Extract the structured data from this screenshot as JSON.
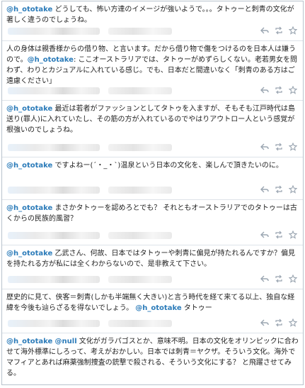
{
  "tweets": [
    {
      "mention": "@h_ototake",
      "segments": [
        {
          "t": "mention",
          "v": "@h_ototake"
        },
        {
          "t": "text",
          "v": " どうしても、怖い方達のイメージが強いようで。。。タトゥーと刺青の文化が著しく違うのでしょうね。"
        }
      ]
    },
    {
      "segments": [
        {
          "t": "text",
          "v": "人の身体は親香様からの借り物、と言います。だから借り物で傷をつけるのを日本人は嫌うので。"
        },
        {
          "t": "mention",
          "v": "@h_ototake"
        },
        {
          "t": "text",
          "v": ": ここオーストラリアでは、タトゥーがめずらしくない。老若男女を問わず、わりとカジュアルに入れている感じ。でも、日本だと間違いなく「刺青のある方はご遠慮ください」"
        }
      ]
    },
    {
      "segments": [
        {
          "t": "mention",
          "v": "@h_ototake"
        },
        {
          "t": "text",
          "v": " 最近は若者がファッションとしてタトゥを入ますが、そもそも江戸時代は島送り(罪人)に入れていたし、その筋の方が入れているのでやはりアウトロー人という感覚が根強いのでしょうね。"
        }
      ]
    },
    {
      "segments": [
        {
          "t": "mention",
          "v": "@h_ototake"
        },
        {
          "t": "text",
          "v": " ですよねー(´・_・`)温泉という日本の文化を、楽しんで頂きたいのに。"
        }
      ]
    },
    {
      "segments": [
        {
          "t": "mention",
          "v": "@h_ototake"
        },
        {
          "t": "text",
          "v": " まさかタトゥーを認めろとでも？ それともオーストラリアでのタトゥーは古くからの民族的風習？"
        }
      ]
    },
    {
      "segments": [
        {
          "t": "mention",
          "v": "@h_ototake"
        },
        {
          "t": "text",
          "v": " 乙武さん、何故、日本ではタトゥーや刺青に偏見が持たれるんですか？偏見を持たれる方が私には全くわからないので、是非教えて下さい。"
        }
      ]
    },
    {
      "segments": [
        {
          "t": "text",
          "v": "歴史的に見て、侠客＝刺青(しかも半端無く大きい)と言う時代を経て来てる以上、独自な経緯を今後も辿らざるを得ないでしょう。 "
        },
        {
          "t": "mention",
          "v": "@h_ototake"
        },
        {
          "t": "text",
          "v": " タトゥー"
        }
      ]
    },
    {
      "segments": [
        {
          "t": "mention",
          "v": "@h_ototake"
        },
        {
          "t": "text",
          "v": " "
        },
        {
          "t": "mention",
          "v": "@null"
        },
        {
          "t": "text",
          "v": " 文化がガラパゴスとか、意味不明。日本の文化をオリンピックに合わせて海外標準にしろって、考えがおかしい。日本では刺青＝ヤクザ。そういう文化。海外でマフィアとあれば麻薬強制捜査の銃撃で殺される、そういう文化にする？ と飛躍させてみる。"
        }
      ]
    }
  ],
  "actions": {
    "reply_icon": "reply-icon",
    "retweet_icon": "retweet-icon",
    "favorite_icon": "star-icon"
  },
  "colors": {
    "mention": "#2b7bb9",
    "border": "#b8c2cc",
    "divider": "#dde3e9",
    "icon": "#9aa5b1"
  }
}
